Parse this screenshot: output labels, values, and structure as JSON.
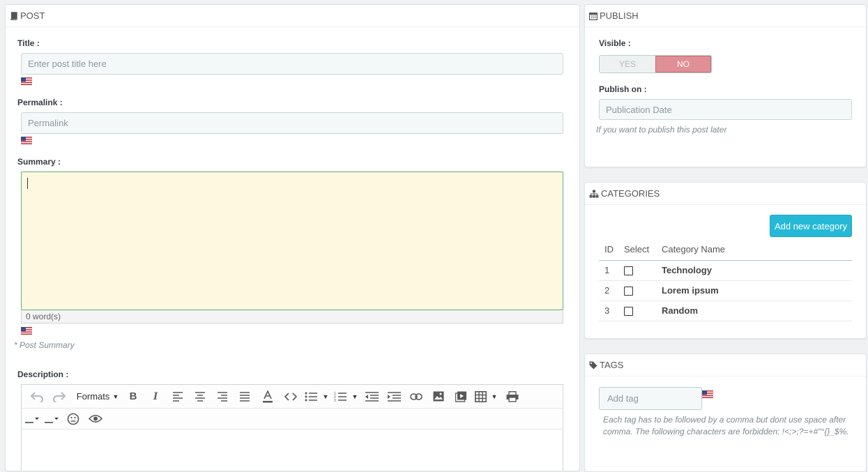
{
  "post": {
    "header": "POST",
    "title_label": "Title :",
    "title_placeholder": "Enter post title here",
    "permalink_label": "Permalink :",
    "permalink_placeholder": "Permalink",
    "summary_label": "Summary :",
    "summary_value": "",
    "word_count": "0 word(s)",
    "summary_help": "* Post Summary",
    "description_label": "Description :",
    "toolbar": {
      "formats_label": "Formats"
    }
  },
  "publish": {
    "header": "PUBLISH",
    "visible_label": "Visible :",
    "yes_label": "YES",
    "no_label": "NO",
    "visible_value": "NO",
    "publish_on_label": "Publish on :",
    "date_placeholder": "Publication Date",
    "date_help": "If you want to publish this post later"
  },
  "categories": {
    "header": "CATEGORIES",
    "add_button": "Add new category",
    "columns": [
      "ID",
      "Select",
      "Category Name"
    ],
    "rows": [
      {
        "id": "1",
        "name": "Technology",
        "checked": false
      },
      {
        "id": "2",
        "name": "Lorem ipsum",
        "checked": false
      },
      {
        "id": "3",
        "name": "Random",
        "checked": false
      }
    ]
  },
  "tags": {
    "header": "TAGS",
    "placeholder": "Add tag",
    "help": "Each tag has to be followed by a comma but dont use space after comma. The following characters are forbidden: !<;>;?=+#\"°{}_$%."
  },
  "colors": {
    "accent": "#25b9d7",
    "no_toggle": "#e08f95",
    "summary_bg": "#fff8e1"
  }
}
